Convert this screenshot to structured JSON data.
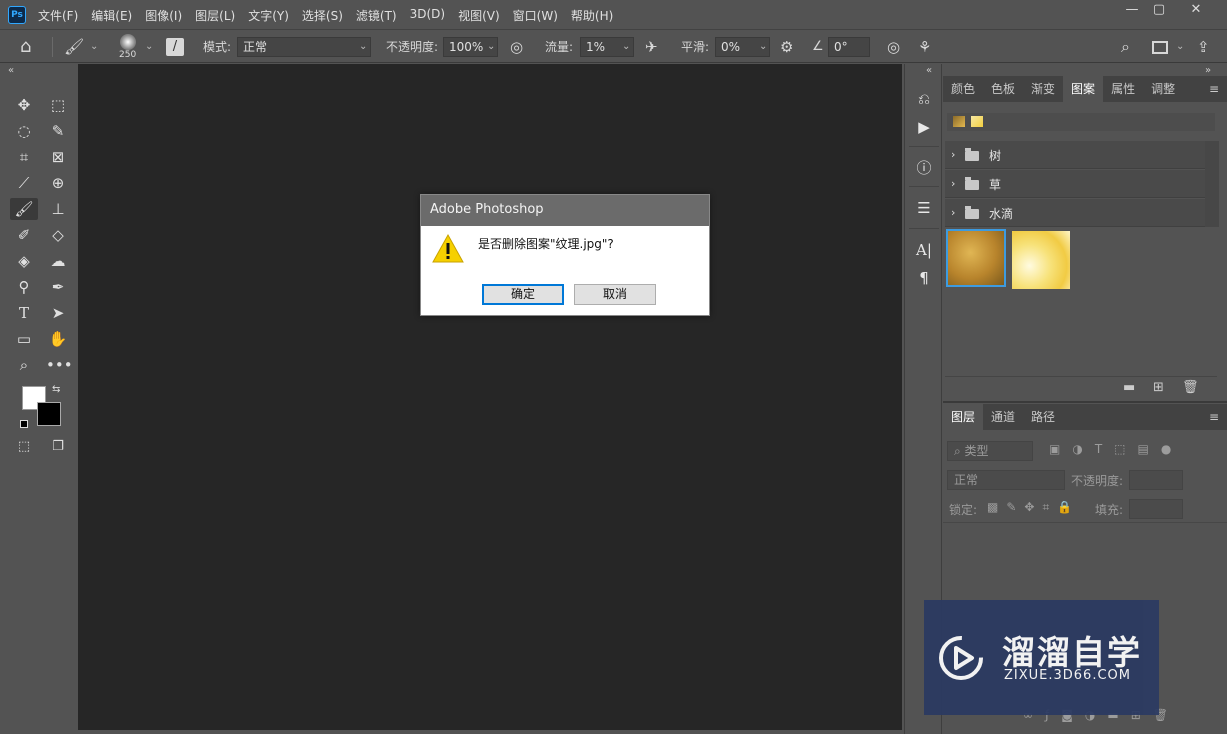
{
  "app": {
    "logo": "Ps"
  },
  "menu": [
    "文件(F)",
    "编辑(E)",
    "图像(I)",
    "图层(L)",
    "文字(Y)",
    "选择(S)",
    "滤镜(T)",
    "3D(D)",
    "视图(V)",
    "窗口(W)",
    "帮助(H)"
  ],
  "window_controls": {
    "minimize": "—",
    "restore": "▢",
    "close": "✕"
  },
  "options": {
    "brush_size": "250",
    "mode_label": "模式:",
    "mode_value": "正常",
    "opacity_label": "不透明度:",
    "opacity_value": "100%",
    "flow_label": "流量:",
    "flow_value": "1%",
    "smooth_label": "平滑:",
    "smooth_value": "0%",
    "angle_value": "0°"
  },
  "collapse_left": "«",
  "collapse_right": "«",
  "collapse_right2": "»",
  "panel_tabs": [
    "颜色",
    "色板",
    "渐变",
    "图案",
    "属性",
    "调整"
  ],
  "panel_active_tab": "图案",
  "pattern_folders": [
    "树",
    "草",
    "水滴"
  ],
  "layers_tabs": [
    "图层",
    "通道",
    "路径"
  ],
  "layers": {
    "filter_placeholder": "类型",
    "blend_mode": "正常",
    "opacity_label": "不透明度:",
    "lock_label": "锁定:",
    "fill_label": "填充:"
  },
  "dialog": {
    "title": "Adobe Photoshop",
    "message": "是否删除图案\"纹理.jpg\"?",
    "ok_label": "确定",
    "cancel_label": "取消"
  },
  "watermark": {
    "brand": "溜溜自学",
    "url": "ZIXUE.3D66.COM"
  },
  "colors": {
    "accent": "#31a8ff",
    "selection": "#3d9be0",
    "warning": "#f6d000"
  }
}
